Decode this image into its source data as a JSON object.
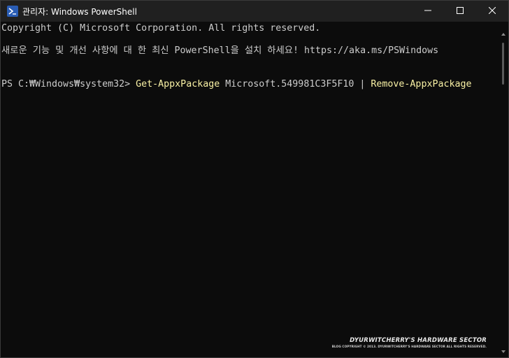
{
  "window": {
    "title": "관리자: Windows PowerShell",
    "icon": "powershell-icon",
    "controls": [
      "minimize-icon",
      "maximize-icon",
      "close-icon"
    ]
  },
  "terminal": {
    "line1": "Copyright (C) Microsoft Corporation. All rights reserved.",
    "line2": "새로운 기능 및 개선 사항에 대 한 최신 PowerShell을 설치 하세요! https://aka.ms/PSWindows",
    "prompt": "PS C:₩Windows₩system32> ",
    "cmd1": "Get-AppxPackage",
    "arg1": " Microsoft.549981C3F5F10 | ",
    "cmd2": "Remove-AppxPackage"
  },
  "watermark": {
    "main": "DYURWITCHERRY'S HARDWARE SECTOR",
    "sub": "BLOG COPYRIGHT © 2013. DYURWITCHERRY'S HARDWARE SECTOR ALL RIGHTS RESERVED."
  },
  "colors": {
    "background": "#0c0c0c",
    "titlebar": "#202020",
    "text": "#cccccc",
    "command": "#f9f1a5"
  }
}
